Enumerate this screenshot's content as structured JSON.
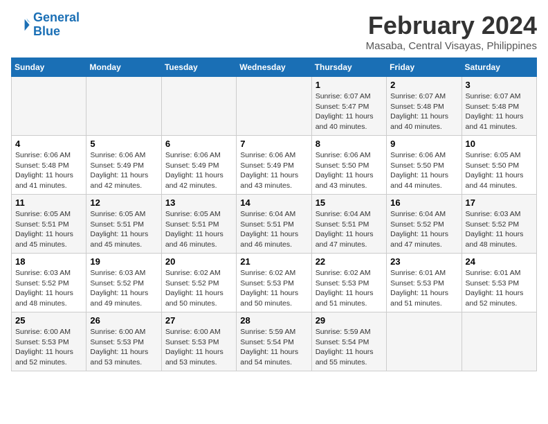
{
  "header": {
    "logo_line1": "General",
    "logo_line2": "Blue",
    "title": "February 2024",
    "subtitle": "Masaba, Central Visayas, Philippines"
  },
  "days_of_week": [
    "Sunday",
    "Monday",
    "Tuesday",
    "Wednesday",
    "Thursday",
    "Friday",
    "Saturday"
  ],
  "weeks": [
    [
      {
        "day": "",
        "info": ""
      },
      {
        "day": "",
        "info": ""
      },
      {
        "day": "",
        "info": ""
      },
      {
        "day": "",
        "info": ""
      },
      {
        "day": "1",
        "info": "Sunrise: 6:07 AM\nSunset: 5:47 PM\nDaylight: 11 hours\nand 40 minutes."
      },
      {
        "day": "2",
        "info": "Sunrise: 6:07 AM\nSunset: 5:48 PM\nDaylight: 11 hours\nand 40 minutes."
      },
      {
        "day": "3",
        "info": "Sunrise: 6:07 AM\nSunset: 5:48 PM\nDaylight: 11 hours\nand 41 minutes."
      }
    ],
    [
      {
        "day": "4",
        "info": "Sunrise: 6:06 AM\nSunset: 5:48 PM\nDaylight: 11 hours\nand 41 minutes."
      },
      {
        "day": "5",
        "info": "Sunrise: 6:06 AM\nSunset: 5:49 PM\nDaylight: 11 hours\nand 42 minutes."
      },
      {
        "day": "6",
        "info": "Sunrise: 6:06 AM\nSunset: 5:49 PM\nDaylight: 11 hours\nand 42 minutes."
      },
      {
        "day": "7",
        "info": "Sunrise: 6:06 AM\nSunset: 5:49 PM\nDaylight: 11 hours\nand 43 minutes."
      },
      {
        "day": "8",
        "info": "Sunrise: 6:06 AM\nSunset: 5:50 PM\nDaylight: 11 hours\nand 43 minutes."
      },
      {
        "day": "9",
        "info": "Sunrise: 6:06 AM\nSunset: 5:50 PM\nDaylight: 11 hours\nand 44 minutes."
      },
      {
        "day": "10",
        "info": "Sunrise: 6:05 AM\nSunset: 5:50 PM\nDaylight: 11 hours\nand 44 minutes."
      }
    ],
    [
      {
        "day": "11",
        "info": "Sunrise: 6:05 AM\nSunset: 5:51 PM\nDaylight: 11 hours\nand 45 minutes."
      },
      {
        "day": "12",
        "info": "Sunrise: 6:05 AM\nSunset: 5:51 PM\nDaylight: 11 hours\nand 45 minutes."
      },
      {
        "day": "13",
        "info": "Sunrise: 6:05 AM\nSunset: 5:51 PM\nDaylight: 11 hours\nand 46 minutes."
      },
      {
        "day": "14",
        "info": "Sunrise: 6:04 AM\nSunset: 5:51 PM\nDaylight: 11 hours\nand 46 minutes."
      },
      {
        "day": "15",
        "info": "Sunrise: 6:04 AM\nSunset: 5:51 PM\nDaylight: 11 hours\nand 47 minutes."
      },
      {
        "day": "16",
        "info": "Sunrise: 6:04 AM\nSunset: 5:52 PM\nDaylight: 11 hours\nand 47 minutes."
      },
      {
        "day": "17",
        "info": "Sunrise: 6:03 AM\nSunset: 5:52 PM\nDaylight: 11 hours\nand 48 minutes."
      }
    ],
    [
      {
        "day": "18",
        "info": "Sunrise: 6:03 AM\nSunset: 5:52 PM\nDaylight: 11 hours\nand 48 minutes."
      },
      {
        "day": "19",
        "info": "Sunrise: 6:03 AM\nSunset: 5:52 PM\nDaylight: 11 hours\nand 49 minutes."
      },
      {
        "day": "20",
        "info": "Sunrise: 6:02 AM\nSunset: 5:52 PM\nDaylight: 11 hours\nand 50 minutes."
      },
      {
        "day": "21",
        "info": "Sunrise: 6:02 AM\nSunset: 5:53 PM\nDaylight: 11 hours\nand 50 minutes."
      },
      {
        "day": "22",
        "info": "Sunrise: 6:02 AM\nSunset: 5:53 PM\nDaylight: 11 hours\nand 51 minutes."
      },
      {
        "day": "23",
        "info": "Sunrise: 6:01 AM\nSunset: 5:53 PM\nDaylight: 11 hours\nand 51 minutes."
      },
      {
        "day": "24",
        "info": "Sunrise: 6:01 AM\nSunset: 5:53 PM\nDaylight: 11 hours\nand 52 minutes."
      }
    ],
    [
      {
        "day": "25",
        "info": "Sunrise: 6:00 AM\nSunset: 5:53 PM\nDaylight: 11 hours\nand 52 minutes."
      },
      {
        "day": "26",
        "info": "Sunrise: 6:00 AM\nSunset: 5:53 PM\nDaylight: 11 hours\nand 53 minutes."
      },
      {
        "day": "27",
        "info": "Sunrise: 6:00 AM\nSunset: 5:53 PM\nDaylight: 11 hours\nand 53 minutes."
      },
      {
        "day": "28",
        "info": "Sunrise: 5:59 AM\nSunset: 5:54 PM\nDaylight: 11 hours\nand 54 minutes."
      },
      {
        "day": "29",
        "info": "Sunrise: 5:59 AM\nSunset: 5:54 PM\nDaylight: 11 hours\nand 55 minutes."
      },
      {
        "day": "",
        "info": ""
      },
      {
        "day": "",
        "info": ""
      }
    ]
  ]
}
